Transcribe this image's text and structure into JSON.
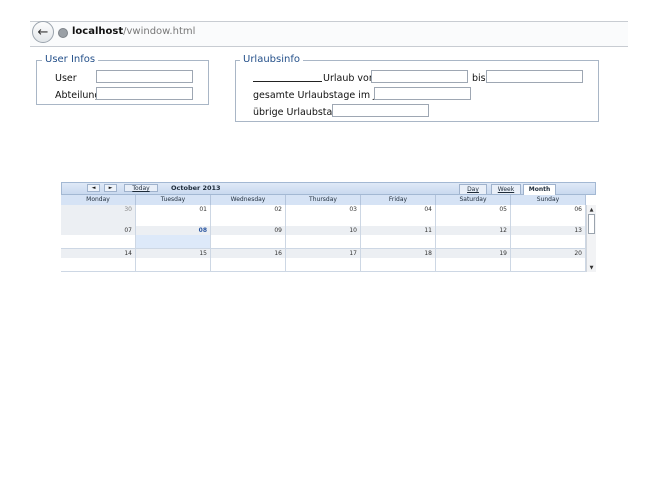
{
  "browser": {
    "url_host": "localhost",
    "url_path": "/vwindow.html"
  },
  "user_infos": {
    "legend": "User Infos",
    "user_label": "User",
    "user_value": "",
    "abteilung_label": "Abteilung",
    "abteilung_value": ""
  },
  "urlaubsinfo": {
    "legend": "Urlaubsinfo",
    "urlaub_vom_label": "Urlaub vom",
    "urlaub_vom_value": "",
    "bis_label": "bis",
    "bis_value": "",
    "gesamte_label": "gesamte Urlaubstage im Jahr",
    "gesamte_value": "",
    "uebrige_label": "übrige Urlaubstage",
    "uebrige_value": ""
  },
  "calendar": {
    "prev_label": "◄",
    "next_label": "►",
    "today_label": "Today",
    "title": "October 2013",
    "views": [
      "Day",
      "Week",
      "Month"
    ],
    "active_view": "Month",
    "weekdays": [
      "Monday",
      "Tuesday",
      "Wednesday",
      "Thursday",
      "Friday",
      "Saturday",
      "Sunday"
    ],
    "weeks": [
      [
        "30",
        "01",
        "02",
        "03",
        "04",
        "05",
        "06"
      ],
      [
        "07",
        "08",
        "09",
        "10",
        "11",
        "12",
        "13"
      ],
      [
        "14",
        "15",
        "16",
        "17",
        "18",
        "19",
        "20"
      ]
    ],
    "other_month_days": [
      "30"
    ],
    "today": "08"
  }
}
